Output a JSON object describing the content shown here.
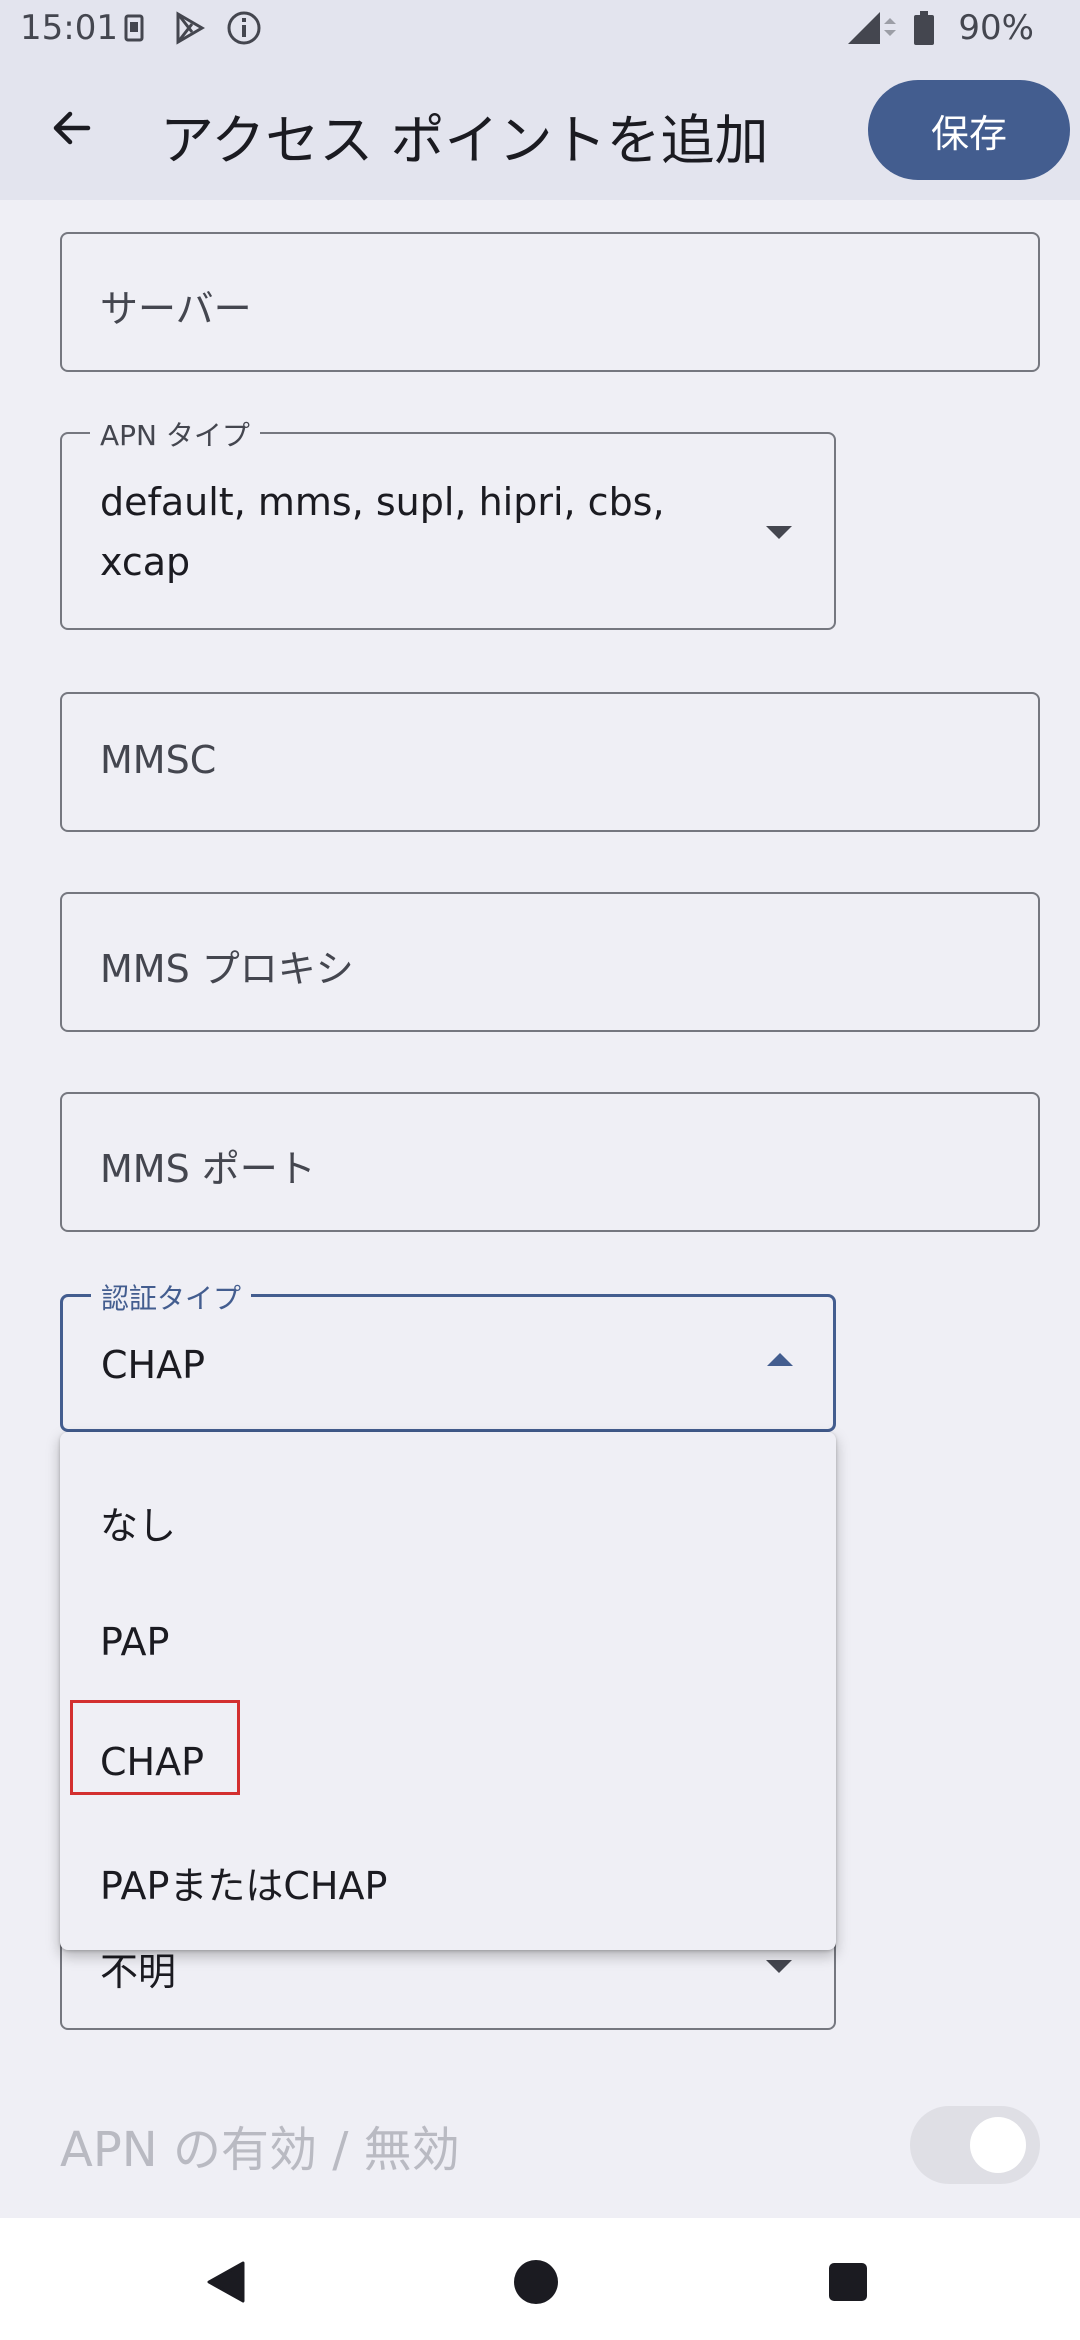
{
  "status_bar": {
    "time": "15:01",
    "battery": "90%",
    "icons": [
      "sim-icon",
      "play-store-icon",
      "info-icon",
      "signal-icon",
      "battery-icon"
    ]
  },
  "app_bar": {
    "title": "アクセス ポイントを追加",
    "save_label": "保存"
  },
  "fields": {
    "server": {
      "placeholder": "サーバー"
    },
    "apn_type": {
      "label": "APN タイプ",
      "value_line1": "default, mms, supl, hipri, cbs,",
      "value_line2": "xcap"
    },
    "mmsc": {
      "placeholder": "MMSC"
    },
    "mms_proxy": {
      "placeholder": "MMS プロキシ"
    },
    "mms_port": {
      "placeholder": "MMS ポート"
    },
    "auth_type": {
      "label": "認証タイプ",
      "value": "CHAP"
    },
    "next_field_value": "不明"
  },
  "auth_menu": {
    "options": [
      "なし",
      "PAP",
      "CHAP",
      "PAPまたはCHAP"
    ],
    "selected": "CHAP"
  },
  "apn_toggle": {
    "label": "APN の有効 / 無効",
    "state": "on-disabled"
  },
  "colors": {
    "accent": "#435d8f",
    "background": "#efeff5",
    "appbar": "#e3e4ee",
    "highlight": "#d32f2f"
  }
}
